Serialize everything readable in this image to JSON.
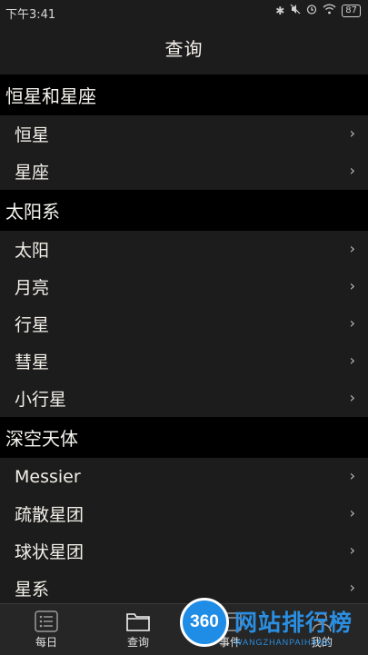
{
  "status": {
    "time": "下午3:41",
    "battery": "87"
  },
  "header": {
    "title": "查询"
  },
  "sections": [
    {
      "title": "恒星和星座",
      "items": [
        "恒星",
        "星座"
      ]
    },
    {
      "title": "太阳系",
      "items": [
        "太阳",
        "月亮",
        "行星",
        "彗星",
        "小行星"
      ]
    },
    {
      "title": "深空天体",
      "items": [
        "Messier",
        "疏散星团",
        "球状星团",
        "星系"
      ]
    }
  ],
  "chevron": "›",
  "tabs": [
    {
      "label": "每日",
      "icon": "list-icon"
    },
    {
      "label": "查询",
      "icon": "folder-icon"
    },
    {
      "label": "事件",
      "icon": "events-icon"
    },
    {
      "label": "我的",
      "icon": "profile-icon"
    }
  ],
  "watermark": {
    "badge": "360",
    "text": "网站排行榜",
    "subtext": "WANGZHANPAIHANG"
  }
}
